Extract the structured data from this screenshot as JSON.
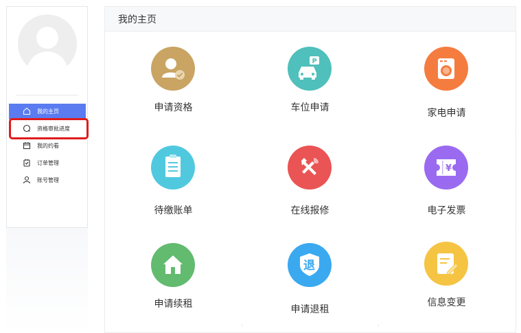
{
  "sidebar": {
    "items": [
      {
        "label": "我的主页",
        "icon": "home-icon",
        "active": true
      },
      {
        "label": "资格审批进度",
        "icon": "progress-icon",
        "active": false
      },
      {
        "label": "我的约看",
        "icon": "calendar-icon",
        "active": false
      },
      {
        "label": "订单管理",
        "icon": "checklist-icon",
        "active": false
      },
      {
        "label": "账号管理",
        "icon": "user-icon",
        "active": false
      }
    ]
  },
  "header": {
    "title": "我的主页"
  },
  "cards": [
    {
      "label": "申请资格",
      "icon": "user-check-icon",
      "color": "#c9a463"
    },
    {
      "label": "车位申请",
      "icon": "parking-car-icon",
      "color": "#4fc0bb"
    },
    {
      "label": "家电申请",
      "icon": "washing-machine-icon",
      "color": "#f57c3f"
    },
    {
      "label": "待缴账单",
      "icon": "bill-icon",
      "color": "#50c9df"
    },
    {
      "label": "在线报修",
      "icon": "repair-tools-icon",
      "color": "#ea5454"
    },
    {
      "label": "电子发票",
      "icon": "invoice-icon",
      "color": "#9a6bf0"
    },
    {
      "label": "申请续租",
      "icon": "house-icon",
      "color": "#62bb6f"
    },
    {
      "label": "申请退租",
      "icon": "shield-checkout-icon",
      "color": "#3aa9f0",
      "glyph": "退"
    },
    {
      "label": "信息变更",
      "icon": "edit-form-icon",
      "color": "#f5c443"
    }
  ],
  "invoice_glyph": "¥"
}
